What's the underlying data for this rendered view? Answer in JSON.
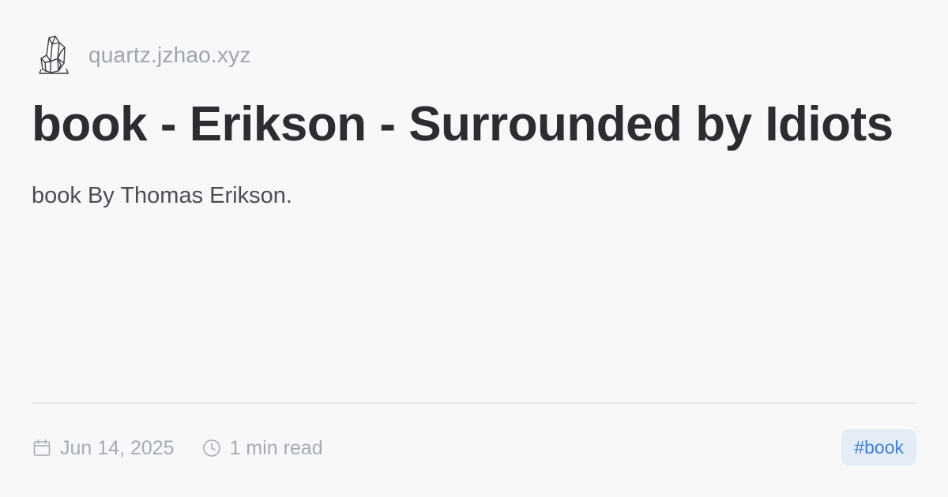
{
  "header": {
    "site_name": "quartz.jzhao.xyz",
    "logo_icon": "crystal-logo-icon"
  },
  "article": {
    "title": "book - Erikson - Surrounded by Idiots",
    "description": "book By Thomas Erikson."
  },
  "meta": {
    "date": "Jun 14, 2025",
    "date_icon": "calendar-icon",
    "read_time": "1 min read",
    "read_time_icon": "clock-icon"
  },
  "tags": [
    {
      "label": "#book"
    }
  ],
  "colors": {
    "background": "#f7f8fa",
    "title": "#2b2d31",
    "muted": "#a6abb2",
    "tag_bg": "#e4ecf7",
    "tag_text": "#3f7fd6"
  }
}
